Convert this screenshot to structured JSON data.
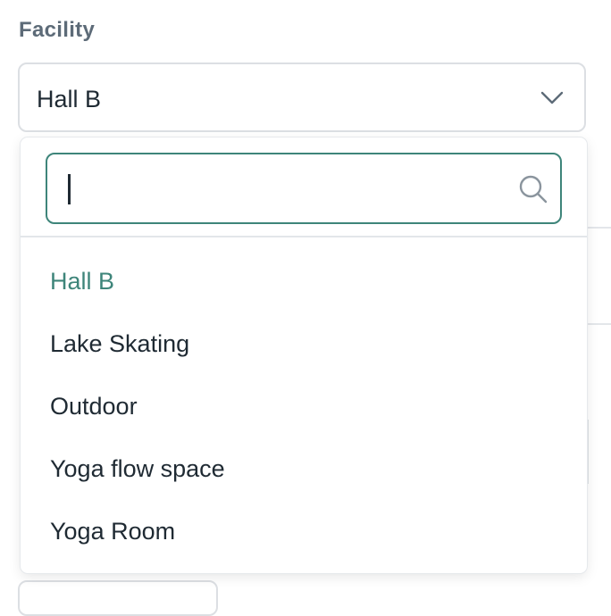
{
  "field": {
    "label": "Facility",
    "selected_value": "Hall B"
  },
  "search": {
    "value": "",
    "placeholder": ""
  },
  "options": [
    {
      "label": "Hall B",
      "selected": true
    },
    {
      "label": "Lake Skating",
      "selected": false
    },
    {
      "label": "Outdoor",
      "selected": false
    },
    {
      "label": "Yoga flow space",
      "selected": false
    },
    {
      "label": "Yoga Room",
      "selected": false
    }
  ],
  "icons": {
    "dropdown": "chevron-down-icon",
    "search": "search-icon"
  },
  "colors": {
    "accent": "#3e857a",
    "label": "#5d6b78",
    "text": "#1f2a33",
    "border": "#dcdfe3"
  }
}
